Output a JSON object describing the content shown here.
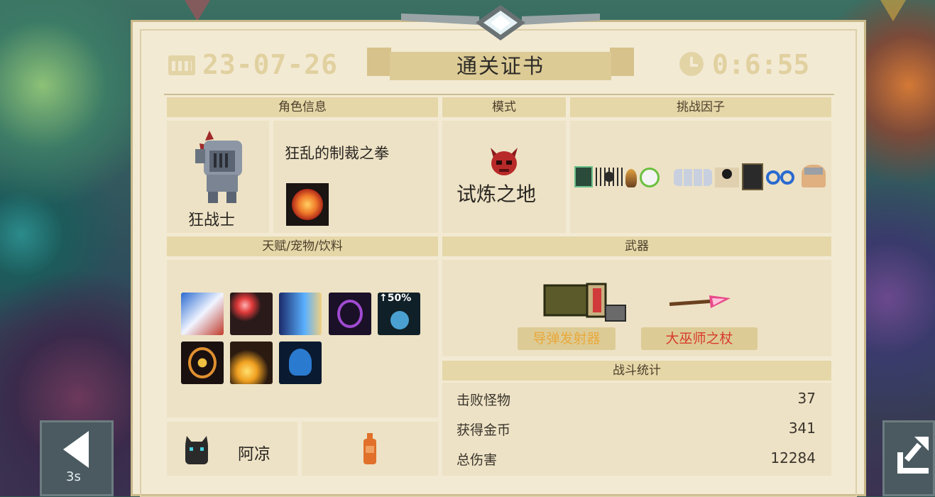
{
  "certificate": {
    "date": "23-07-26",
    "title": "通关证书",
    "time": "0:6:55"
  },
  "sections": {
    "character_info": "角色信息",
    "mode": "模式",
    "challenge_factors": "挑战因子",
    "talents_pets_drinks": "天赋/宠物/饮料",
    "weapons": "武器",
    "battle_stats": "战斗统计"
  },
  "character": {
    "name": "狂战士",
    "relic": "狂乱的制裁之拳",
    "relic_icon": "fire-fist-icon"
  },
  "mode": {
    "name": "试炼之地",
    "icon": "red-demon-mask-icon"
  },
  "challenge_factors": [
    "green-rune-icon",
    "black-spider-icon",
    "torch-icon",
    "stopwatch-icon",
    "skeleton-group-icon",
    "bomb-crate-icon",
    "dark-tablet-icon",
    "infinity-icon",
    "viking-helmet-icon"
  ],
  "talents": [
    "punch-rush-icon",
    "red-orb-icon",
    "arrow-volley-icon",
    "purple-shield-icon",
    "plus-fifty-percent-icon",
    "golden-shield-icon",
    "spark-burst-icon",
    "blue-mind-icon"
  ],
  "talent_badge": "↑50%",
  "pet": {
    "name": "阿凉",
    "icon": "black-cat-icon"
  },
  "drink": {
    "icon": "orange-bottle-icon"
  },
  "weapons": [
    {
      "name": "导弹发射器",
      "color": "#e8a93a",
      "icon": "missile-launcher-icon"
    },
    {
      "name": "大巫师之杖",
      "color": "#d63a2a",
      "icon": "archmage-staff-icon"
    }
  ],
  "stats": [
    {
      "label": "击败怪物",
      "value": "37"
    },
    {
      "label": "获得金币",
      "value": "341"
    },
    {
      "label": "总伤害",
      "value": "12284"
    }
  ],
  "controls": {
    "back_countdown": "3s",
    "back_icon": "back-arrow-icon",
    "share_icon": "share-icon"
  }
}
